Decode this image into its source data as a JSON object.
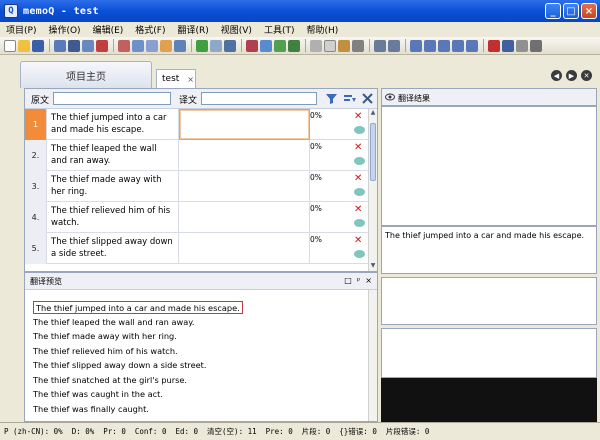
{
  "window": {
    "title": "memoQ - test",
    "icon_letter": "Q"
  },
  "menu": [
    "项目(P)",
    "操作(O)",
    "编辑(E)",
    "格式(F)",
    "翻译(R)",
    "视图(V)",
    "工具(T)",
    "帮助(H)"
  ],
  "tabs": {
    "home": "项目主页",
    "doc": "test",
    "doc_close": "×"
  },
  "grid": {
    "source_label": "原文",
    "target_label": "译文",
    "rows": [
      {
        "num": "1",
        "source": "The thief jumped into a car and made his escape.",
        "pct": "0%"
      },
      {
        "num": "2.",
        "source": "The thief leaped the wall and ran away.",
        "pct": "0%"
      },
      {
        "num": "3.",
        "source": "The thief made away with her ring.",
        "pct": "0%"
      },
      {
        "num": "4.",
        "source": "The thief relieved him of his watch.",
        "pct": "0%"
      },
      {
        "num": "5.",
        "source": "The thief slipped away down a side street.",
        "pct": "0%"
      }
    ]
  },
  "preview": {
    "title": "翻译预览",
    "controls": [
      "□",
      "ᵖ",
      "×"
    ],
    "lines": [
      "The thief jumped into a car and made his escape.",
      "The thief leaped the wall and ran away.",
      "The thief made away with her ring.",
      "The thief relieved him of his watch.",
      "The thief slipped away down a side street.",
      "The thief snatched at the girl's purse.",
      "The thief was caught in the act.",
      "The thief was finally caught."
    ]
  },
  "right_panel": {
    "title": "翻译结果",
    "source_text": "The thief jumped into a car and made his escape."
  },
  "status": [
    "P (zh-CN): 0%",
    "D: 0%",
    "Pr: 0",
    "Conf: 0",
    "Ed: 0",
    "清空(空): 11",
    "Pre: 0",
    "片段: 0",
    "{}错误: 0",
    "片段错误: 0"
  ],
  "colors": {
    "title_bar": "#0a4fd6",
    "active_row": "#f28c3a",
    "delete_mark": "#d01818",
    "comment_bubble": "#7fc6bf"
  }
}
